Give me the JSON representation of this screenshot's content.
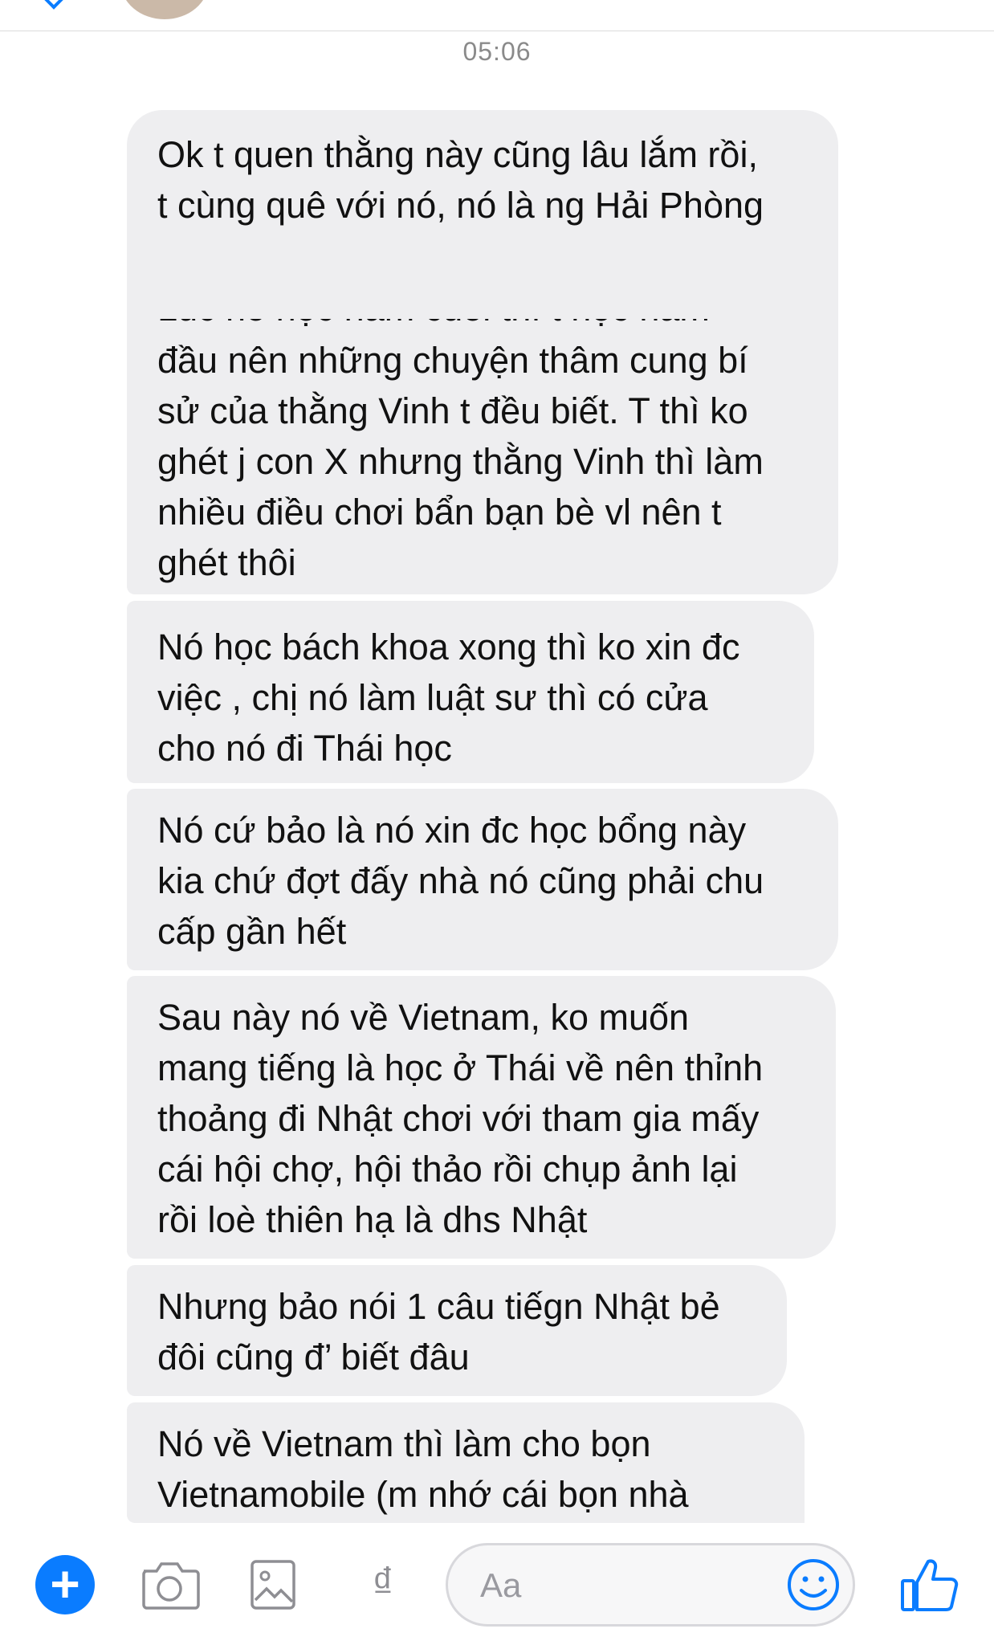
{
  "header": {
    "back_icon": "chevron-left-icon",
    "avatar_icon": "contact-avatar"
  },
  "thread": {
    "timestamp": "05:06",
    "messages": [
      {
        "lines": [
          "Ok t quen thằng này cũng lâu lắm rồi,",
          "t cùng quê với nó, nó là ng Hải Phòng"
        ],
        "clipped_line": "Lúc nó học năm cuối thì t học năm",
        "lines_after": [
          "đầu nên những chuyện thâm cung bí",
          "sử của thằng Vinh t đều biết. T thì ko",
          "ghét j con X nhưng thằng Vinh thì làm",
          "nhiều điều chơi bẩn bạn bè vl nên t",
          "ghét thôi"
        ]
      },
      {
        "lines": [
          "Nó học bách khoa xong thì ko xin đc",
          "việc , chị nó làm luật sư thì có cửa",
          "cho nó đi Thái học"
        ]
      },
      {
        "lines": [
          "Nó cứ bảo là nó xin đc học bổng này",
          "kia chứ đợt đấy nhà nó cũng phải chu",
          "cấp gần hết"
        ]
      },
      {
        "lines": [
          "Sau này nó về Vietnam, ko muốn",
          "mang tiếng là học ở Thái về nên thỉnh",
          "thoảng đi Nhật chơi với tham gia mấy",
          "cái hội chợ, hội thảo rồi chụp ảnh lại",
          "rồi loè thiên hạ là dhs Nhật"
        ]
      },
      {
        "lines": [
          "Nhưng bảo nói 1 câu tiếgn Nhật bẻ",
          "đôi cũng đ’ biết đâu"
        ]
      },
      {
        "lines": [
          "Nó về Vietnam thì làm cho bọn",
          "Vietnamobile (m nhớ cái bọn nhà"
        ]
      }
    ]
  },
  "composer": {
    "plus_icon": "plus",
    "camera_icon": "camera-icon",
    "gallery_icon": "image-gallery-icon",
    "dong_symbol": "₫",
    "input_placeholder": "Aa",
    "emoji_icon": "emoji-icon",
    "like_icon": "thumbs-up-icon",
    "accent_color": "#0a7cff"
  }
}
